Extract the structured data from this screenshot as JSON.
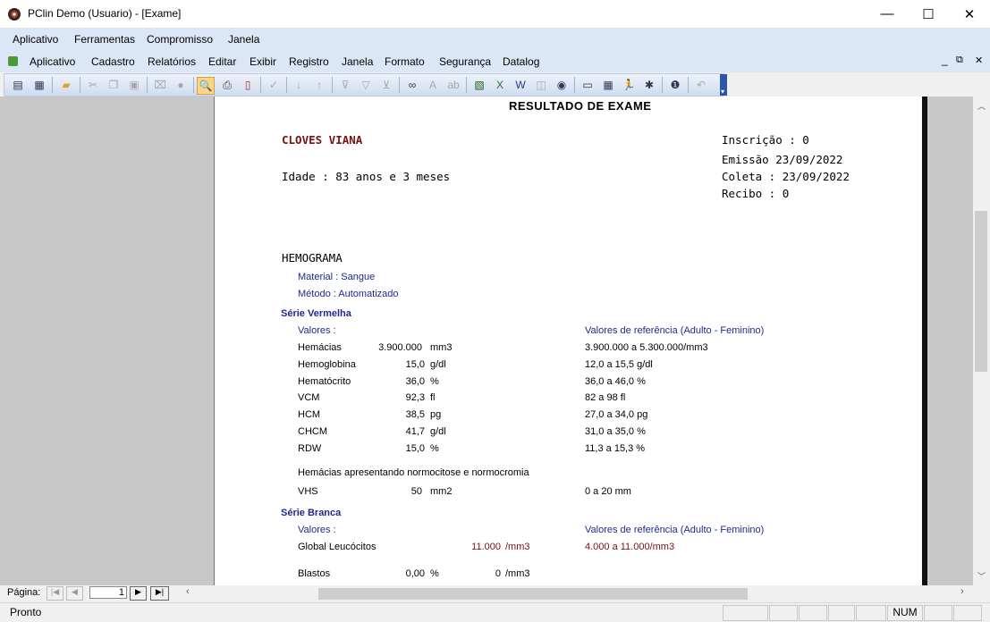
{
  "window": {
    "title": "PClin Demo (Usuario) - [Exame]",
    "minimize": "—",
    "maximize": "☐",
    "close": "✕"
  },
  "menubar1": [
    "Aplicativo",
    "Ferramentas",
    "Compromisso",
    "Janela"
  ],
  "menubar2": [
    "Aplicativo",
    "Cadastro",
    "Relatórios",
    "Editar",
    "Exibir",
    "Registro",
    "Janela",
    "Formato",
    "Segurança",
    "Datalog"
  ],
  "mdi": {
    "minimize": "_",
    "restore": "⧉",
    "close": "✕"
  },
  "toolbar_icons": [
    "form-view-icon",
    "datasheet-view-icon",
    "open-folder-icon",
    "cut-icon",
    "copy-icon",
    "paste-icon",
    "format-painter-icon",
    "find-user-icon",
    "print-preview-icon",
    "print-icon",
    "pdf-icon",
    "spellcheck-icon",
    "sort-asc-icon",
    "sort-desc-icon",
    "filter-selection-icon",
    "filter-icon",
    "remove-filter-icon",
    "binoculars-icon",
    "find-next-icon",
    "replace-icon",
    "word-export-icon",
    "excel-export-icon",
    "mail-merge-icon",
    "access-icon",
    "database-icon",
    "book-icon",
    "calculator-icon",
    "runner-icon",
    "new-record-icon",
    "help-icon",
    "undo-icon"
  ],
  "report": {
    "header": "RESULTADO DE EXAME",
    "patient_name": "CLOVES VIANA",
    "age": "Idade : 83 anos e 3 meses",
    "inscricao": "Inscrição : 0",
    "emissao": "Emissão  23/09/2022",
    "coleta": "Coleta :  23/09/2022",
    "recibo": "Recibo : 0",
    "exam_title": "HEMOGRAMA",
    "material": "Material : Sangue",
    "metodo": "Método : Automatizado",
    "serie_vermelha": {
      "title": "Série Vermelha",
      "valores_label": "Valores :",
      "ref_label": "Valores de referência   (Adulto - Feminino)",
      "rows": [
        {
          "name": "Hemácias",
          "value": "3.900.000",
          "unit": "mm3",
          "ref": "3.900.000 a 5.300.000/mm3"
        },
        {
          "name": "Hemoglobina",
          "value": "15,0",
          "unit": "g/dl",
          "ref": "12,0 a 15,5 g/dl"
        },
        {
          "name": "Hematócrito",
          "value": "36,0",
          "unit": "%",
          "ref": "36,0 a 46,0 %"
        },
        {
          "name": "VCM",
          "value": "92,3",
          "unit": "fl",
          "ref": "82 a 98 fl"
        },
        {
          "name": "HCM",
          "value": "38,5",
          "unit": "pg",
          "ref": "27,0 a 34,0 pg"
        },
        {
          "name": "CHCM",
          "value": "41,7",
          "unit": "g/dl",
          "ref": "31,0 a 35,0 %"
        },
        {
          "name": "RDW",
          "value": "15,0",
          "unit": "%",
          "ref": "11,3 a 15,3 %"
        }
      ],
      "note": "Hemácias apresentando normocitose e normocromia",
      "vhs": {
        "name": "VHS",
        "value": "50",
        "unit": "mm2",
        "ref": "0 a 20 mm"
      }
    },
    "serie_branca": {
      "title": "Série Branca",
      "valores_label": "Valores :",
      "ref_label": "Valores de referência   (Adulto - Feminino)",
      "leuco": {
        "name": "Global Leucócitos",
        "value": "11.000",
        "unit": "/mm3",
        "ref": "4.000 a 11.000/mm3"
      },
      "blastos": {
        "name": "Blastos",
        "pct": "0,00",
        "pct_unit": "%",
        "abs": "0",
        "abs_unit": "/mm3"
      }
    }
  },
  "pager": {
    "label": "Página:",
    "value": "1"
  },
  "status": {
    "text": "Pronto",
    "num": "NUM"
  }
}
